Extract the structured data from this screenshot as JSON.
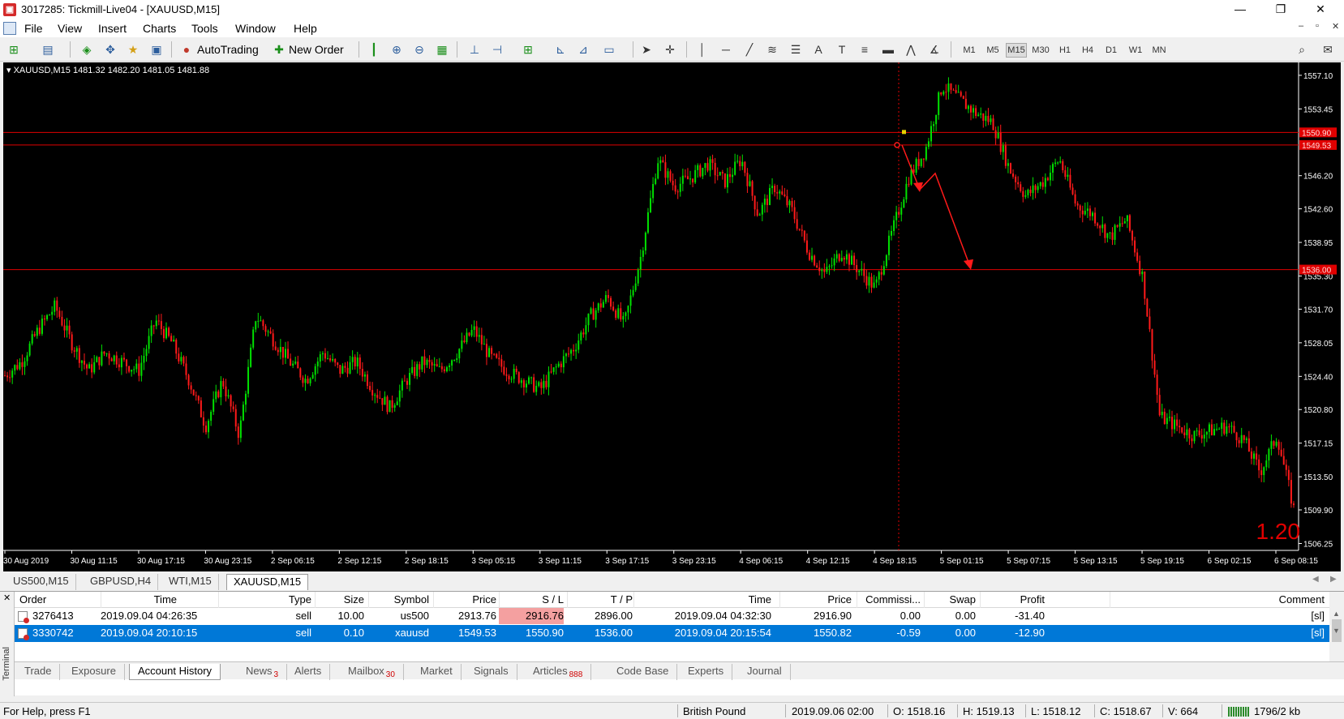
{
  "window": {
    "title": "3017285: Tickmill-Live04 - [XAUUSD,M15]",
    "controls": {
      "minimize": "—",
      "restore": "❐",
      "close": "✕"
    }
  },
  "menu": {
    "items": [
      "File",
      "View",
      "Insert",
      "Charts",
      "Tools",
      "Window",
      "Help"
    ],
    "doc_controls": [
      "–",
      "▫",
      "✕"
    ]
  },
  "toolbar": {
    "autotrading_label": "AutoTrading",
    "neworder_label": "New Order",
    "timeframes": [
      "M1",
      "M5",
      "M15",
      "M30",
      "H1",
      "H4",
      "D1",
      "W1",
      "MN"
    ],
    "active_timeframe": "M15"
  },
  "chart": {
    "symbol_info": "XAUUSD,M15  1481.32 1482.20 1481.05 1481.88",
    "big_number": "1.20",
    "price_axis": [
      "1557.10",
      "1553.45",
      "1546.20",
      "1542.60",
      "1538.95",
      "1535.30",
      "1531.70",
      "1528.05",
      "1524.40",
      "1520.80",
      "1517.15",
      "1513.50",
      "1509.90",
      "1506.25"
    ],
    "hline_labels": [
      "1550.90",
      "1549.53",
      "1536.00"
    ],
    "time_axis": [
      "30 Aug 2019",
      "30 Aug 11:15",
      "30 Aug 17:15",
      "30 Aug 23:15",
      "2 Sep 06:15",
      "2 Sep 12:15",
      "2 Sep 18:15",
      "3 Sep 05:15",
      "3 Sep 11:15",
      "3 Sep 17:15",
      "3 Sep 23:15",
      "4 Sep 06:15",
      "4 Sep 12:15",
      "4 Sep 18:15",
      "5 Sep 01:15",
      "5 Sep 07:15",
      "5 Sep 13:15",
      "5 Sep 19:15",
      "6 Sep 02:15",
      "6 Sep 08:15"
    ],
    "colors": {
      "bull": "#00e000",
      "bear": "#ff1a1a",
      "background": "#000000",
      "hline": "#e00000"
    },
    "price_min": 1505.5,
    "price_max": 1558.5,
    "price_path": [
      1524.5,
      1526.0,
      1529.5,
      1532.0,
      1528.0,
      1525.0,
      1527.0,
      1526.0,
      1525.0,
      1530.5,
      1528.0,
      1524.0,
      1519.0,
      1524.0,
      1518.0,
      1531.0,
      1528.5,
      1526.0,
      1524.0,
      1527.0,
      1525.0,
      1526.0,
      1523.0,
      1521.0,
      1524.0,
      1526.0,
      1525.0,
      1527.0,
      1529.5,
      1526.5,
      1525.0,
      1524.0,
      1523.0,
      1525.5,
      1527.5,
      1531.0,
      1533.0,
      1530.0,
      1537.5,
      1548.0,
      1545.0,
      1546.0,
      1547.5,
      1545.5,
      1548.0,
      1542.0,
      1545.0,
      1542.5,
      1538.0,
      1535.5,
      1538.0,
      1536.0,
      1534.0,
      1540.0,
      1546.0,
      1549.0,
      1556.0,
      1554.5,
      1553.0,
      1552.0,
      1547.0,
      1544.0,
      1545.5,
      1548.0,
      1543.0,
      1542.0,
      1539.5,
      1541.5,
      1535.0,
      1520.0,
      1519.0,
      1518.0,
      1518.5,
      1519.0,
      1517.5,
      1514.0,
      1518.0,
      1510.0
    ]
  },
  "chart_tabs": [
    "US500,M15",
    "GBPUSD,H4",
    "WTI,M15",
    "XAUUSD,M15"
  ],
  "active_chart_tab": "XAUUSD,M15",
  "terminal": {
    "side_label": "Terminal",
    "columns": [
      "Order",
      "Time",
      "Type",
      "Size",
      "Symbol",
      "Price",
      "S / L",
      "T / P",
      "Time",
      "Price",
      "Commissi...",
      "Swap",
      "Profit",
      "Comment"
    ],
    "rows": [
      [
        "3276413",
        "2019.09.04 04:26:35",
        "sell",
        "10.00",
        "us500",
        "2913.76",
        "2916.76",
        "2896.00",
        "2019.09.04 04:32:30",
        "2916.90",
        "0.00",
        "0.00",
        "-31.40",
        "[sl]"
      ],
      [
        "3330742",
        "2019.09.04 20:10:15",
        "sell",
        "0.10",
        "xauusd",
        "1549.53",
        "1550.90",
        "1536.00",
        "2019.09.04 20:15:54",
        "1550.82",
        "-0.59",
        "0.00",
        "-12.90",
        "[sl]"
      ]
    ],
    "tabs": [
      {
        "label": "Trade",
        "badge": ""
      },
      {
        "label": "Exposure",
        "badge": ""
      },
      {
        "label": "Account History",
        "badge": ""
      },
      {
        "label": "News",
        "badge": "3"
      },
      {
        "label": "Alerts",
        "badge": ""
      },
      {
        "label": "Mailbox",
        "badge": "30"
      },
      {
        "label": "Market",
        "badge": ""
      },
      {
        "label": "Signals",
        "badge": ""
      },
      {
        "label": "Articles",
        "badge": "888"
      },
      {
        "label": "Code Base",
        "badge": ""
      },
      {
        "label": "Experts",
        "badge": ""
      },
      {
        "label": "Journal",
        "badge": ""
      }
    ],
    "active_tab": "Account History"
  },
  "status": {
    "help": "For Help, press F1",
    "profile": "British Pound",
    "datetime": "2019.09.06 02:00",
    "open": "O: 1518.16",
    "high": "H: 1519.13",
    "low": "L: 1518.12",
    "close": "C: 1518.67",
    "volume": "V: 664",
    "traffic": "1796/2 kb"
  }
}
